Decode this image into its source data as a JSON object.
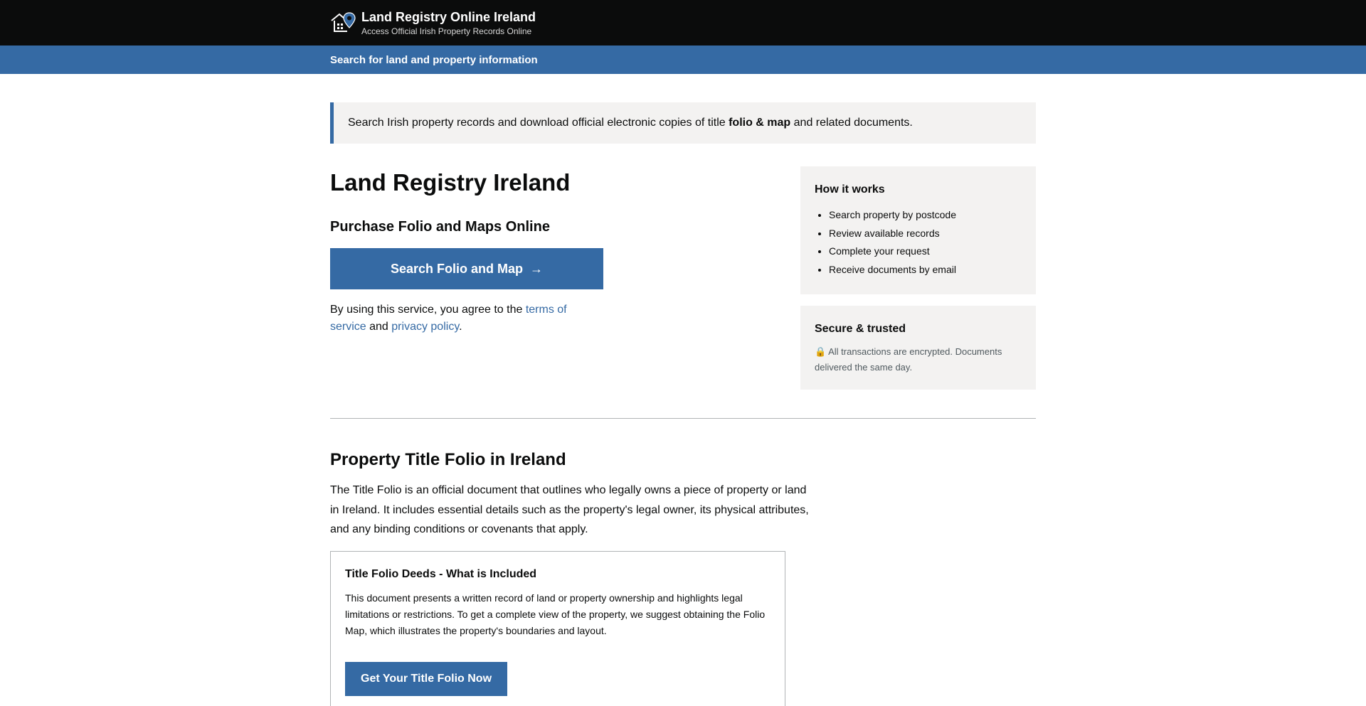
{
  "header": {
    "logo_icon": "house-location-pin-icon",
    "title": "Land Registry Online Ireland",
    "subtitle": "Access Official Irish Property Records Online"
  },
  "subnav": {
    "link": "Search for land and property information"
  },
  "notice": {
    "prefix": "Search Irish property records and download official electronic copies of title ",
    "bold": "folio & map",
    "suffix": " and related documents."
  },
  "main": {
    "title": "Land Registry Ireland",
    "subtitle": "Purchase Folio and Maps Online",
    "cta_label": "Search Folio and Map",
    "cta_arrow": "→",
    "terms": {
      "prefix": "By using this service, you agree to the ",
      "terms_link": "terms of service",
      "middle": " and ",
      "privacy_link": "privacy policy",
      "suffix": "."
    }
  },
  "sidebar": {
    "how_title": "How it works",
    "steps": [
      "Search property by postcode",
      "Review available records",
      "Complete your request",
      "Receive documents by email"
    ],
    "secure_title": "Secure & trusted",
    "secure_icon": "🔒",
    "secure_text": "All transactions are encrypted. Documents delivered the same day."
  },
  "section": {
    "title": "Property Title Folio in Ireland",
    "body": "The Title Folio is an official document that outlines who legally owns a piece of property or land in Ireland. It includes essential details such as the property's legal owner, its physical attributes, and any binding conditions or covenants that apply.",
    "card": {
      "title": "Title Folio Deeds - What is Included",
      "body": "This document presents a written record of land or property ownership and highlights legal limitations or restrictions. To get a complete view of the property, we suggest obtaining the Folio Map, which illustrates the property's boundaries and layout.",
      "button": "Get Your Title Folio Now"
    }
  },
  "colors": {
    "header_bg": "#0b0c0c",
    "accent": "#356aa4",
    "panel_bg": "#f3f2f1"
  }
}
